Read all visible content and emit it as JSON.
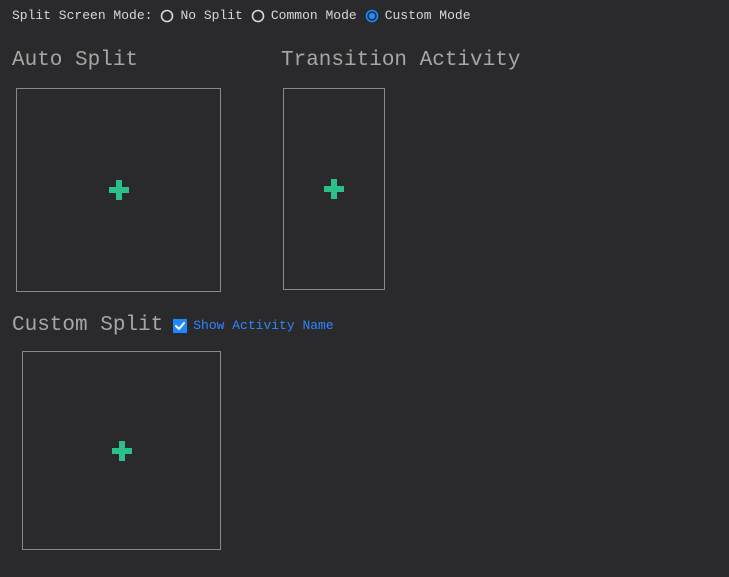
{
  "mode": {
    "label": "Split Screen Mode:",
    "options": {
      "no_split": "No Split",
      "common": "Common Mode",
      "custom": "Custom Mode"
    },
    "selected": "custom"
  },
  "sections": {
    "auto_split": {
      "title": "Auto Split"
    },
    "transition": {
      "title": "Transition Activity"
    },
    "custom_split": {
      "title": "Custom Split",
      "show_activity_name_label": "Show Activity Name",
      "show_activity_name_checked": true
    }
  },
  "icons": {
    "plus": "plus-icon",
    "radio_unselected": "radio-unselected-icon",
    "radio_selected": "radio-selected-icon",
    "checkbox_checked": "checkbox-checked-icon"
  }
}
